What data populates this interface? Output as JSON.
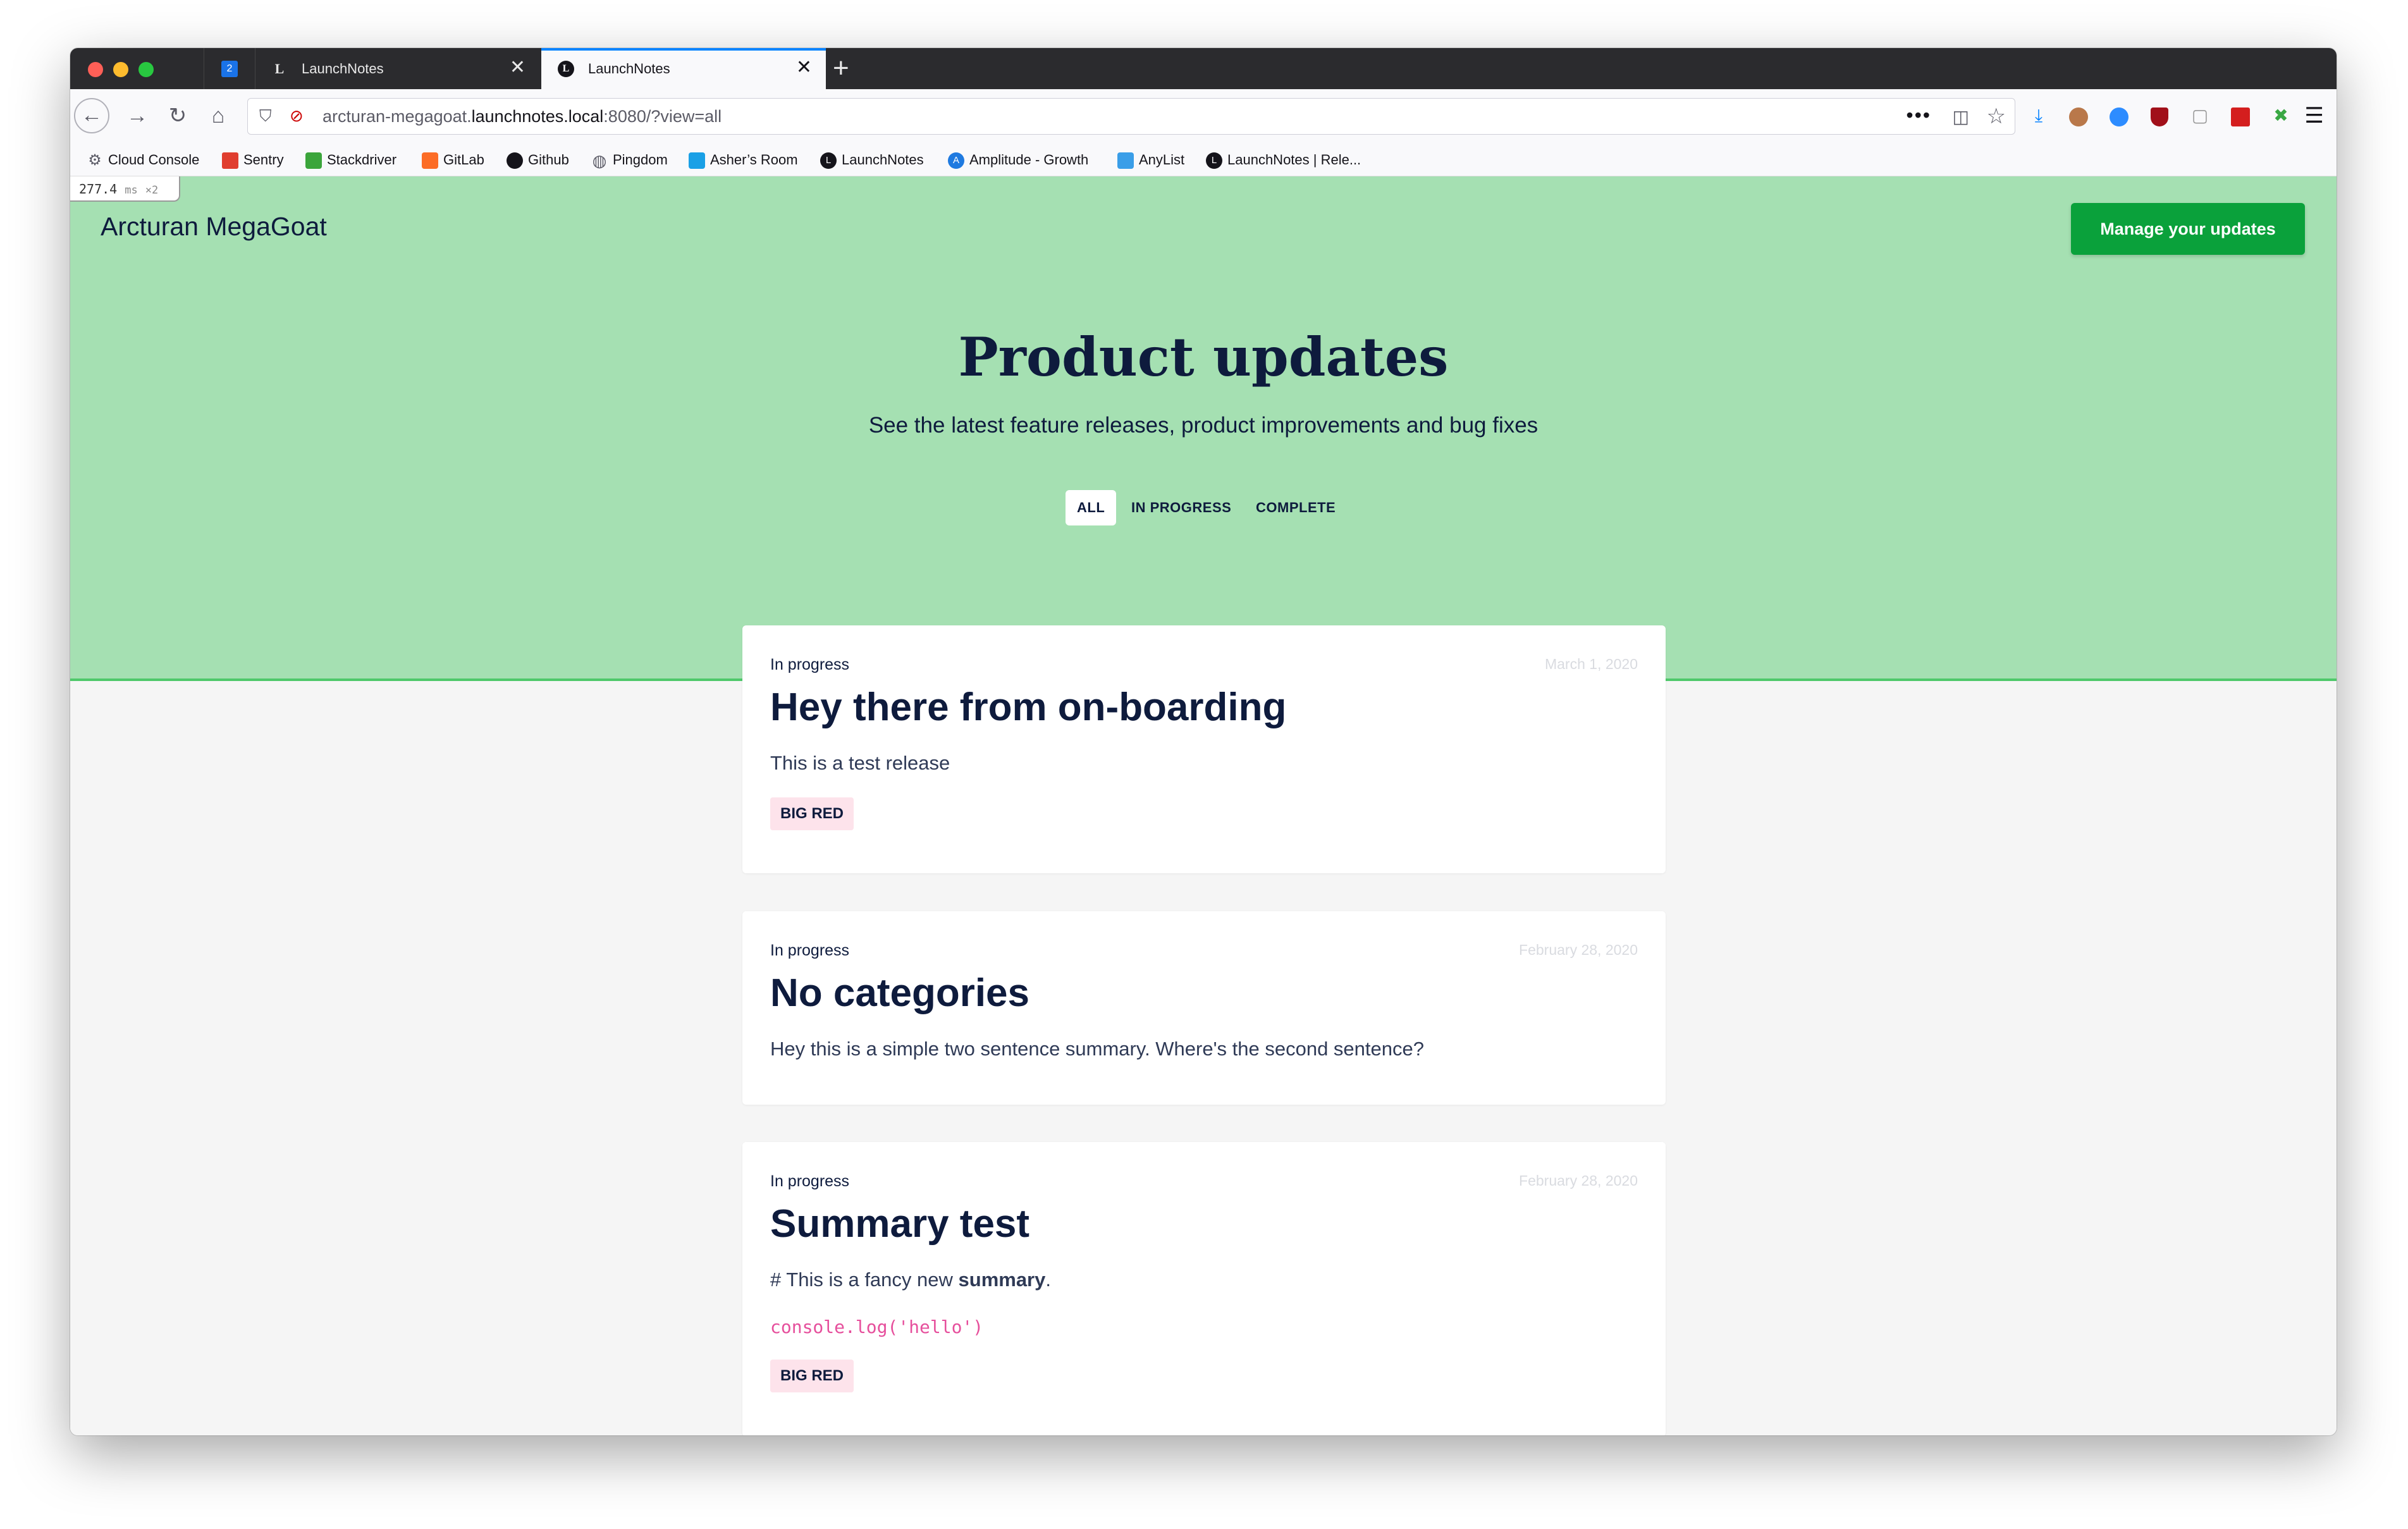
{
  "browser": {
    "pinned_tab_badge": "2",
    "tabs": [
      {
        "favicon": "L",
        "label": "LaunchNotes",
        "close": "✕"
      },
      {
        "favicon": "L",
        "label": "LaunchNotes",
        "close": "✕"
      }
    ],
    "new_tab": "+",
    "url": {
      "prefix": "arcturan-megagoat.",
      "host": "launchnotes.local",
      "suffix": ":8080/?view=all"
    },
    "url_more": "•••",
    "bookmarks": [
      {
        "label": "Cloud Console",
        "icon": "gear-icon",
        "color": "#5b5b66"
      },
      {
        "label": "Sentry",
        "icon": "sentry-icon",
        "color": "#e03e2f"
      },
      {
        "label": "Stackdriver",
        "icon": "stackdriver-icon",
        "color": "#3ba53b"
      },
      {
        "label": "GitLab",
        "icon": "gitlab-icon",
        "color": "#fc6d26"
      },
      {
        "label": "Github",
        "icon": "github-icon",
        "color": "#15141a"
      },
      {
        "label": "Pingdom",
        "icon": "globe-icon",
        "color": "#5b5b66"
      },
      {
        "label": "Asher’s Room",
        "icon": "room-icon",
        "color": "#1aa0e6"
      },
      {
        "label": "LaunchNotes",
        "icon": "launchnotes-icon",
        "color": "#15141a"
      },
      {
        "label": "Amplitude - Growth",
        "icon": "amplitude-icon",
        "color": "#1f7ae0"
      },
      {
        "label": "AnyList",
        "icon": "list-icon",
        "color": "#3a9ee8"
      },
      {
        "label": "LaunchNotes | Rele...",
        "icon": "launchnotes-icon",
        "color": "#15141a"
      }
    ],
    "perf_value": "277.4",
    "perf_unit": "ms",
    "perf_mult": "×2"
  },
  "page": {
    "brand": "Arcturan MegaGoat",
    "manage_button": "Manage your updates",
    "title": "Product updates",
    "subtitle": "See the latest feature releases, product improvements and bug fixes",
    "filters": [
      "ALL",
      "IN PROGRESS",
      "COMPLETE"
    ],
    "active_filter": "ALL",
    "accent_color": "#a5e0b2",
    "button_color": "#0aa13b"
  },
  "cards": [
    {
      "status": "In progress",
      "date": "March 1, 2020",
      "title": "Hey there from on-boarding",
      "summary": "This is a test release",
      "tag": "BIG RED"
    },
    {
      "status": "In progress",
      "date": "February 28, 2020",
      "title": "No categories",
      "summary": "Hey this is a simple two sentence summary. Where's the second sentence?"
    },
    {
      "status": "In progress",
      "date": "February 28, 2020",
      "title": "Summary test",
      "summary_prefix": "# This is a fancy new ",
      "summary_bold": "summary",
      "summary_suffix": ".",
      "code": "console.log('hello')",
      "tag": "BIG RED"
    }
  ]
}
